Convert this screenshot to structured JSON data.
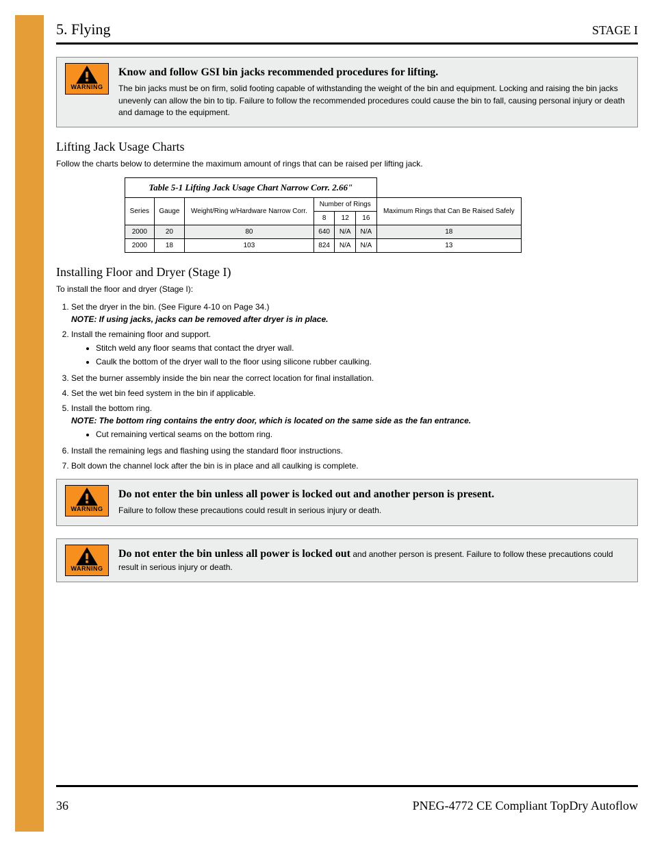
{
  "header": {
    "section_no": "5.",
    "section_title": "Flying",
    "right_label": "STAGE I"
  },
  "warn1": {
    "caption": "Know and follow GSI bin jacks recommended procedures for lifting.",
    "body": "The bin jacks must be on firm, solid footing capable of withstanding the weight of the bin and equipment. Locking and raising the bin jacks unevenly can allow the bin to tip. Failure to follow the recommended procedures could cause the bin to fall, causing personal injury or death and damage to the equipment."
  },
  "sub_heading_lift": "Lifting Jack Usage Charts",
  "para_lift": "Follow the charts below to determine the maximum amount of rings that can be raised per lifting jack.",
  "chart_data": {
    "type": "table",
    "title": "Table 5-1 Lifting Jack Usage Chart Narrow Corr. 2.66\"",
    "columns": [
      "Series",
      "Gauge",
      "Weight/Ring w/Hardware Narrow Corr.",
      {
        "label": "Number of Rings",
        "sub": [
          "8",
          "12",
          "16"
        ]
      },
      "Maximum Rings that Can Be Raised Safely"
    ],
    "rows": [
      {
        "series": "2000",
        "gauge": "20",
        "wt": "80",
        "r8": "640",
        "r12": "N/A",
        "r16": "N/A",
        "max": "18"
      },
      {
        "series": "2000",
        "gauge": "18",
        "wt": "103",
        "r8": "824",
        "r12": "N/A",
        "r16": "N/A",
        "max": "13"
      }
    ]
  },
  "sub_heading_floor": "Installing Floor and Dryer (Stage I)",
  "floor_intro": "To install the floor and dryer (Stage I):",
  "floor_steps": [
    {
      "text": "Set the dryer in the bin. (See Figure 4-10 on Page 34.)",
      "note": "NOTE: If using jacks, jacks can be removed after dryer is in place."
    },
    {
      "text": "Install the remaining floor and support.",
      "bullets": [
        "Stitch weld any floor seams that contact the dryer wall.",
        "Caulk the bottom of the dryer wall to the floor using silicone rubber caulking."
      ]
    },
    {
      "text": "Set the burner assembly inside the bin near the correct location for final installation."
    },
    {
      "text": "Set the wet bin feed system in the bin if applicable."
    },
    {
      "text": "Install the bottom ring.",
      "note": "NOTE: The bottom ring contains the entry door, which is located on the same side as the fan entrance.",
      "bullets": [
        "Cut remaining vertical seams on the bottom ring."
      ]
    },
    {
      "text": "Install the remaining legs and flashing using the standard floor instructions."
    },
    {
      "text": "Bolt down the channel lock after the bin is in place and all caulking is complete."
    }
  ],
  "warn2": {
    "caption": "Do not enter the bin unless all power is locked out and another person is present.",
    "body": "Failure to follow these precautions could result in serious injury or death."
  },
  "warn3": {
    "caption": "Do not enter the bin unless all power is locked out",
    "body": "and another person is present. Failure to follow these precautions could result in serious injury or death."
  },
  "footer": {
    "page": "36",
    "doc": "PNEG-4772 CE Compliant TopDry Autoflow"
  },
  "warn_label": "WARNING"
}
